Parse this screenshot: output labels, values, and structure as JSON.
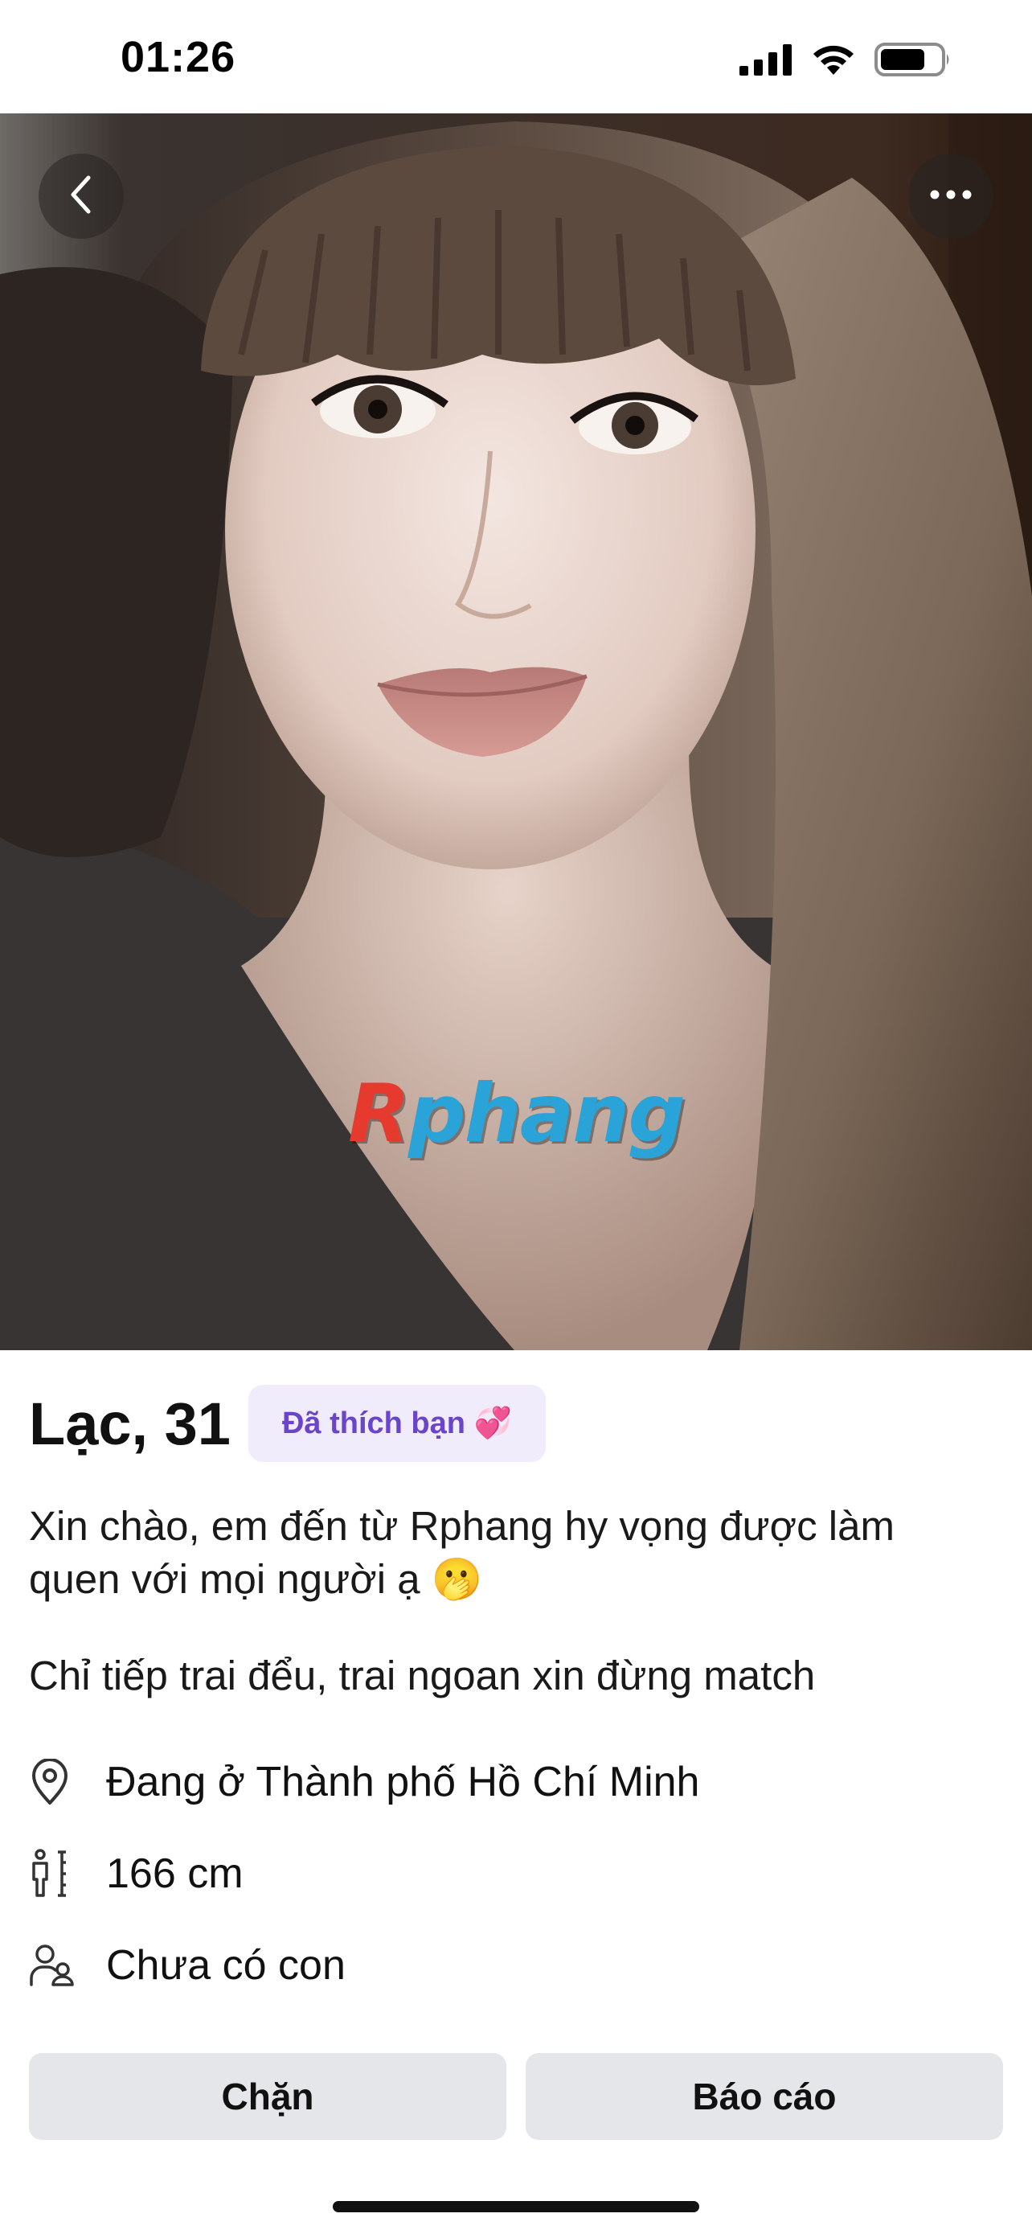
{
  "status_bar": {
    "time": "01:26",
    "signal_icon": "cellular-signal-icon",
    "wifi_icon": "wifi-icon",
    "battery_icon": "battery-icon",
    "battery_level": 0.7
  },
  "photo": {
    "back_icon": "chevron-left-icon",
    "more_icon": "more-horizontal-icon",
    "watermark_first": "R",
    "watermark_rest": "phang"
  },
  "profile": {
    "name_age": "Lạc, 31",
    "liked_badge": "Đã thích bạn 💞",
    "bio": "Xin chào, em đến từ Rphang hy vọng được làm\nquen với mọi người ạ 🫢",
    "bio_extra": "Chỉ tiếp trai đểu, trai ngoan xin đừng match",
    "facts": [
      {
        "icon": "location-pin-icon",
        "text": "Đang ở Thành phố Hồ Chí Minh"
      },
      {
        "icon": "height-icon",
        "text": "166 cm"
      },
      {
        "icon": "children-icon",
        "text": "Chưa có con"
      }
    ]
  },
  "actions": {
    "block_label": "Chặn",
    "report_label": "Báo cáo"
  },
  "colors": {
    "badge_bg": "#f1ecfc",
    "badge_text": "#6b45c9",
    "button_bg": "#e5e6ea",
    "watermark_blue": "#2aa3d9",
    "watermark_red": "#e63a2e"
  }
}
